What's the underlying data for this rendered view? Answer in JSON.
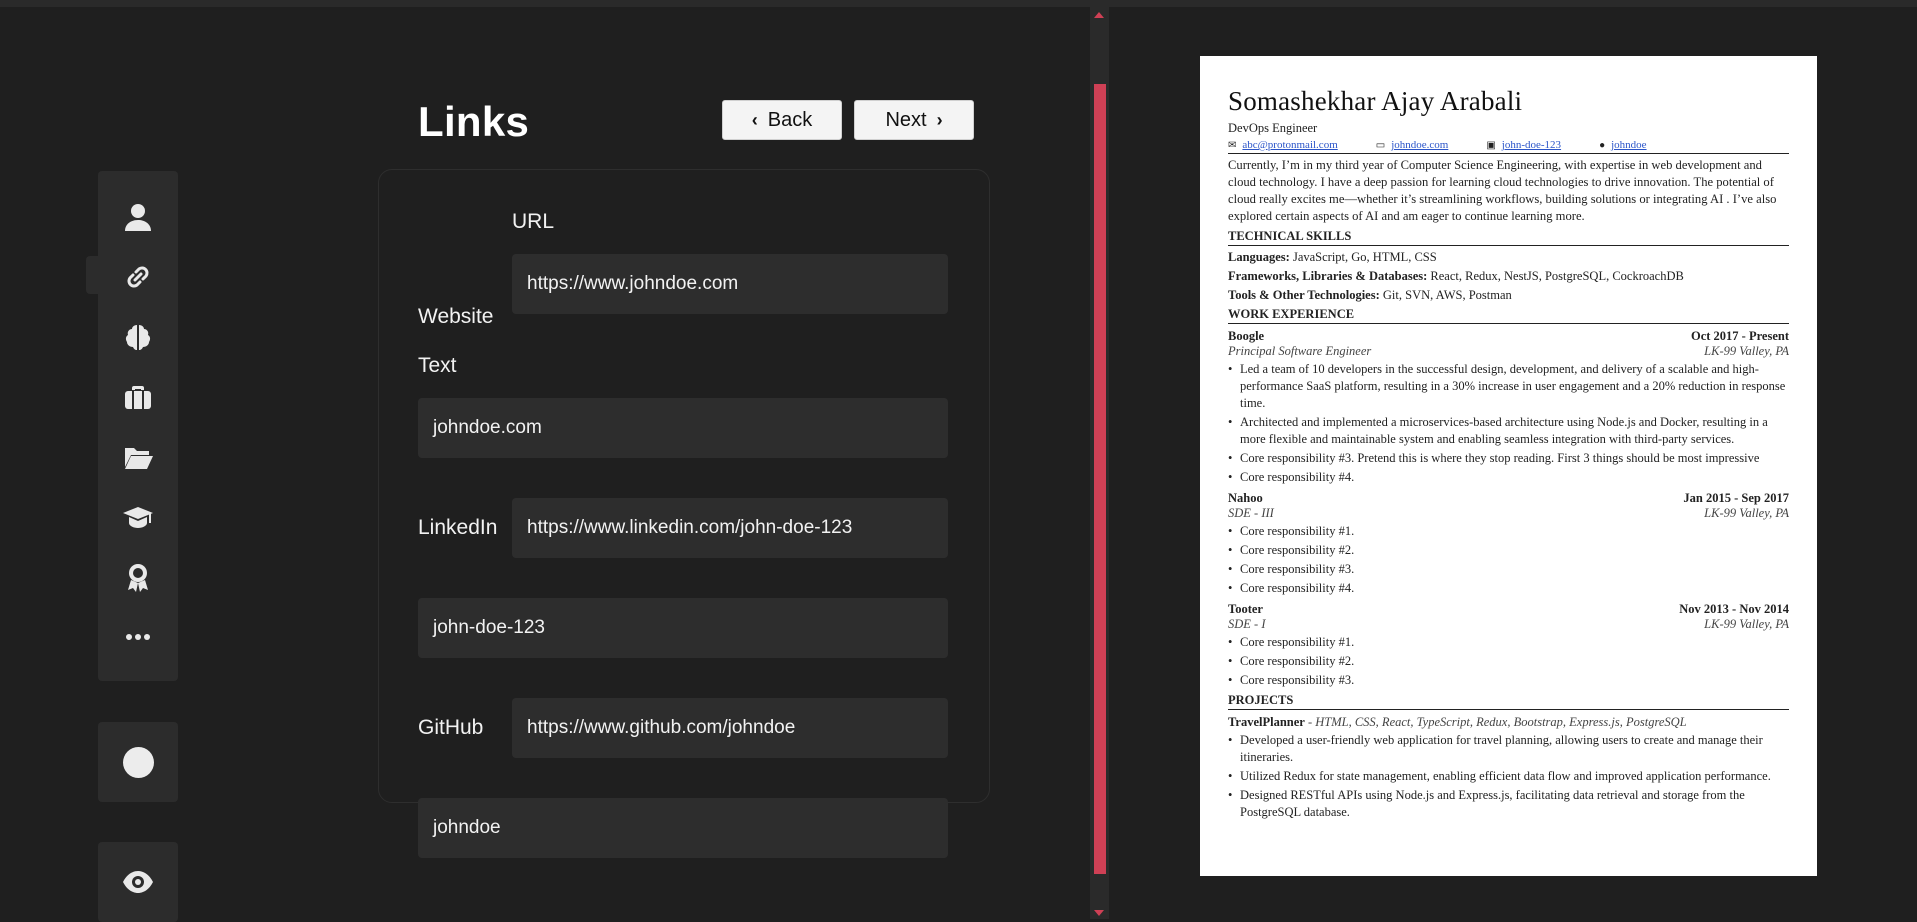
{
  "colors": {
    "background": "#1f1f1f",
    "accent": "#cf4055",
    "panel": "#2c2c2c",
    "field": "#2d2d2d"
  },
  "sidebar": {
    "items": [
      {
        "icon": "user-icon"
      },
      {
        "icon": "link-icon"
      },
      {
        "icon": "brain-icon"
      },
      {
        "icon": "briefcase-icon"
      },
      {
        "icon": "folder-open-icon"
      },
      {
        "icon": "graduation-cap-icon"
      },
      {
        "icon": "award-icon"
      },
      {
        "icon": "more-icon"
      }
    ],
    "active_index": 1
  },
  "header": {
    "title": "Links",
    "back_label": "Back",
    "next_label": "Next"
  },
  "form": {
    "url_header": "URL",
    "text_header": "Text",
    "website": {
      "label": "Website",
      "url": "https://www.johndoe.com",
      "text": "johndoe.com"
    },
    "linkedin": {
      "label": "LinkedIn",
      "url": "https://www.linkedin.com/john-doe-123",
      "text": "john-doe-123"
    },
    "github": {
      "label": "GitHub",
      "url": "https://www.github.com/johndoe",
      "text": "johndoe"
    }
  },
  "resume": {
    "name": "Somashekhar Ajay Arabali",
    "role": "DevOps Engineer",
    "contacts": [
      "abc@protonmail.com",
      "johndoe.com",
      "john-doe-123",
      "johndoe"
    ],
    "summary": "Currently, I’m in my third year of Computer Science Engineering, with expertise in web development and cloud technology. I have a deep passion for learning cloud technologies to drive innovation. The potential of cloud really excites me—whether it’s streamlining workflows, building solutions or integrating AI . I’ve also explored certain aspects of AI and am eager to continue learning more.",
    "skills_title": "TECHNICAL SKILLS",
    "skills": [
      {
        "label": "Languages:",
        "value": "JavaScript, Go, HTML, CSS"
      },
      {
        "label": "Frameworks, Libraries & Databases:",
        "value": "React, Redux, NestJS, PostgreSQL, CockroachDB"
      },
      {
        "label": "Tools & Other Technologies:",
        "value": "Git, SVN, AWS, Postman"
      }
    ],
    "experience_title": "WORK EXPERIENCE",
    "jobs": [
      {
        "company": "Boogle",
        "dates": "Oct 2017 - Present",
        "title": "Principal Software Engineer",
        "location": "LK-99 Valley, PA",
        "bullets": [
          "Led a team of 10 developers in the successful design, development, and delivery of a scalable and high-performance SaaS platform, resulting in a 30% increase in user engagement and a 20% reduction in response time.",
          "Architected and implemented a microservices-based architecture using Node.js and Docker, resulting in a more flexible and maintainable system and enabling seamless integration with third-party services.",
          "Core responsibility #3. Pretend this is where they stop reading. First 3 things should be most impressive",
          "Core responsibility #4."
        ]
      },
      {
        "company": "Nahoo",
        "dates": "Jan 2015 - Sep 2017",
        "title": "SDE - III",
        "location": "LK-99 Valley, PA",
        "bullets": [
          "Core responsibility #1.",
          "Core responsibility #2.",
          "Core responsibility #3.",
          "Core responsibility #4."
        ]
      },
      {
        "company": "Tooter",
        "dates": "Nov 2013 - Nov 2014",
        "title": "SDE - I",
        "location": "LK-99 Valley, PA",
        "bullets": [
          "Core responsibility #1.",
          "Core responsibility #2.",
          "Core responsibility #3."
        ]
      }
    ],
    "projects_title": "PROJECTS",
    "project": {
      "name": "TravelPlanner",
      "stack": " - HTML, CSS, React, TypeScript, Redux, Bootstrap, Express.js, PostgreSQL",
      "bullets": [
        "Developed a user-friendly web application for travel planning, allowing users to create and manage their itineraries.",
        "Utilized Redux for state management, enabling efficient data flow and improved application performance.",
        "Designed RESTful APIs using Node.js and Express.js, facilitating data retrieval and storage from the PostgreSQL database."
      ]
    }
  }
}
